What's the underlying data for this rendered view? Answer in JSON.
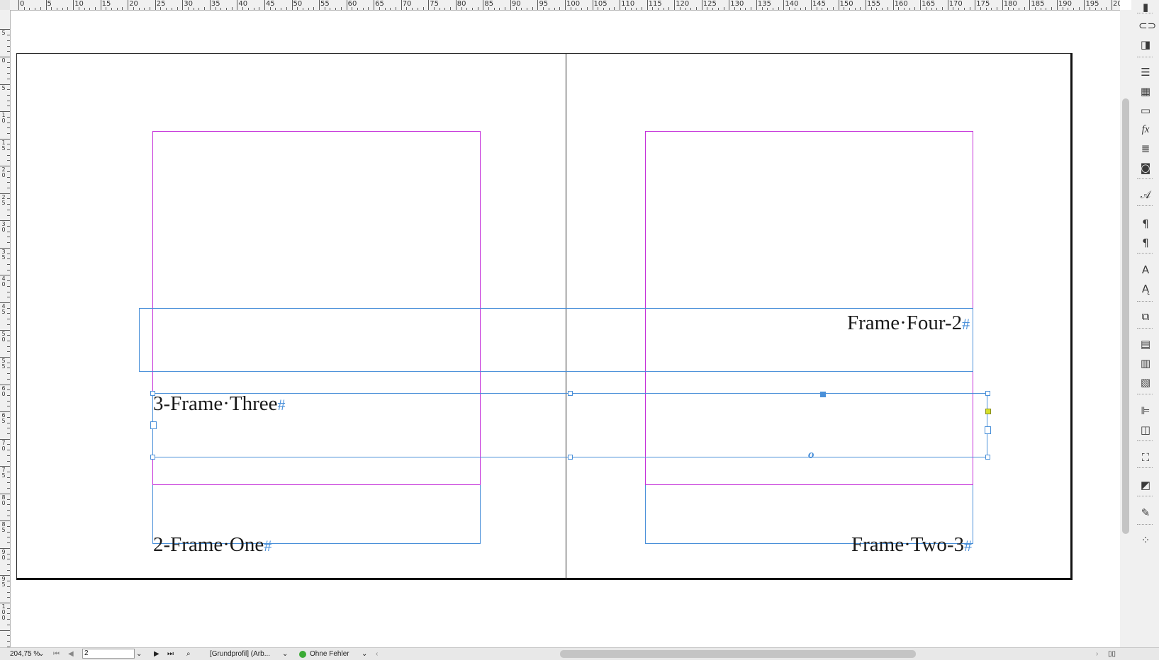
{
  "ruler": {
    "top_labels": [
      "0",
      "5",
      "10",
      "15",
      "20",
      "25",
      "30",
      "35",
      "40",
      "45",
      "50",
      "55",
      "60",
      "65",
      "70",
      "75",
      "80",
      "85",
      "90",
      "95",
      "100",
      "105",
      "110",
      "115",
      "120",
      "125",
      "130",
      "135",
      "140",
      "145",
      "150",
      "155",
      "160",
      "165",
      "170",
      "175",
      "180",
      "185",
      "190",
      "195",
      "20"
    ],
    "left_labels": [
      "5",
      "0",
      "5",
      "10",
      "15",
      "20",
      "25",
      "30",
      "35",
      "40",
      "45",
      "50",
      "55",
      "60",
      "65",
      "70",
      "75",
      "80",
      "85",
      "90",
      "95",
      "100"
    ]
  },
  "document": {
    "frames": [
      {
        "id": "frame-four",
        "text": "Frame·Four-2",
        "mark": "#"
      },
      {
        "id": "frame-three",
        "text": "3-Frame·Three",
        "mark": "#"
      },
      {
        "id": "frame-one",
        "text": "2-Frame·One",
        "mark": "#"
      },
      {
        "id": "frame-two",
        "text": "Frame·Two-3",
        "mark": "#"
      }
    ],
    "overflow_marker": "o",
    "colors": {
      "frame": "#4a90d9",
      "margin": "#c430d9",
      "selected_handle": "#4a90d9",
      "anchor_handle": "#d6e02a"
    }
  },
  "toolbar_icons": [
    "pages-icon",
    "links-icon",
    "layers-icon",
    "stroke-icon",
    "swatches-icon",
    "gradient-icon",
    "effects-icon",
    "text-wrap-icon",
    "object-styles-icon",
    "character-styles-icon",
    "paragraph-icon",
    "paragraph-styles-icon",
    "character-icon",
    "glyphs-icon",
    "transform-icon",
    "table-icon",
    "table-styles-icon",
    "cell-styles-icon",
    "align-icon",
    "pathfinder-icon",
    "layout-adjust-icon",
    "image-icon",
    "script-icon",
    "color-theme-icon"
  ],
  "status": {
    "zoom": "204,75 %",
    "page_number": "2",
    "profile": "[Grundprofil] (Arb...",
    "preflight": "Ohne Fehler"
  }
}
